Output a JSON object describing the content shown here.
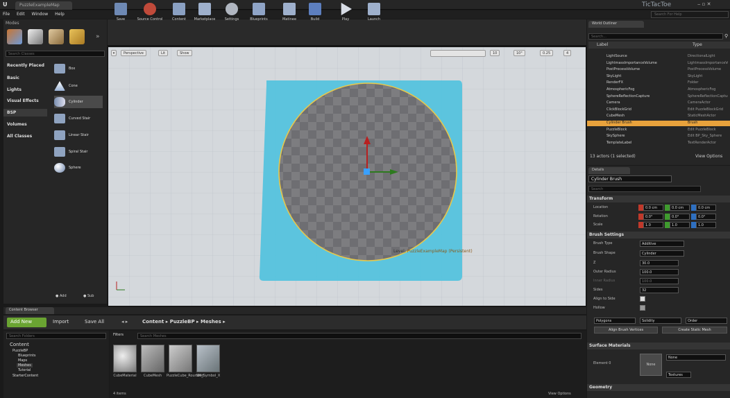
{
  "app": {
    "tab_label": "PuzzleExampleMap",
    "title": "TicTacToe",
    "search_help": "Search For Help"
  },
  "menu": [
    "File",
    "Edit",
    "Window",
    "Help"
  ],
  "modes": {
    "tab": "Modes",
    "search_placeholder": "Search Classes",
    "categories": [
      "Recently Placed",
      "Basic",
      "Lights",
      "Visual Effects",
      "BSP",
      "Volumes",
      "All Classes"
    ],
    "items": [
      "Box",
      "Cone",
      "Cylinder",
      "Curved Stair",
      "Linear Stair",
      "Spiral Stair",
      "Sphere"
    ],
    "footer": [
      "Add",
      "Sub"
    ]
  },
  "toolbar": [
    "Save",
    "Source Control",
    "Content",
    "Marketplace",
    "Settings",
    "Blueprints",
    "Matinee",
    "Build",
    "Play",
    "Launch"
  ],
  "viewport": {
    "perspective": "Perspective",
    "lit": "Lit",
    "show": "Show",
    "grid": "10",
    "angle": "10°",
    "scale": "0.25",
    "cams": "4",
    "level_prefix": "Level: ",
    "level_name": "PuzzleExampleMap (Persistent)"
  },
  "outliner": {
    "tab": "World Outliner",
    "search_placeholder": "Search...",
    "col_label": "Label",
    "col_type": "Type",
    "rows": [
      {
        "label": "LightSource",
        "type": "DirectionalLight"
      },
      {
        "label": "LightmassImportanceVolume",
        "type": "LightmassImportanceVolume"
      },
      {
        "label": "PostProcessVolume",
        "type": "PostProcessVolume"
      },
      {
        "label": "SkyLight",
        "type": "SkyLight"
      },
      {
        "label": "RenderFX",
        "type": "Folder"
      },
      {
        "label": "AtmosphericFog",
        "type": "AtmosphericFog"
      },
      {
        "label": "SphereReflectionCapture",
        "type": "SphereReflectionCapture"
      },
      {
        "label": "Camera",
        "type": "CameraActor"
      },
      {
        "label": "ClickBlockGrid",
        "type": "Edit PuzzleBlockGrid"
      },
      {
        "label": "CubeMesh",
        "type": "StaticMeshActor"
      },
      {
        "label": "Cylinder Brush",
        "type": "Brush"
      },
      {
        "label": "PuzzleBlock",
        "type": "Edit PuzzleBlock"
      },
      {
        "label": "SkySphere",
        "type": "Edit BP_Sky_Sphere"
      },
      {
        "label": "TemplateLabel",
        "type": "TextRenderActor"
      }
    ],
    "status": "13 actors (1 selected)",
    "view_options": "View Options"
  },
  "details": {
    "tab": "Details",
    "actor_name": "Cylinder Brush",
    "search_placeholder": "Search",
    "transform": "Transform",
    "location": "Location",
    "rotation": "Rotation",
    "scale": "Scale",
    "loc": [
      "0.0 cm",
      "0.0 cm",
      "0.0 cm"
    ],
    "rot": [
      "0.0°",
      "0.0°",
      "0.0°"
    ],
    "scl": [
      "1.0",
      "1.0",
      "1.0"
    ],
    "brush_settings": "Brush Settings",
    "brush_type": "Brush Type",
    "brush_type_val": "Additive",
    "brush_shape": "Brush Shape",
    "brush_shape_val": "Cylinder",
    "z": "Z",
    "z_val": "30.0",
    "outer": "Outer Radius",
    "outer_val": "100.0",
    "inner": "Inner Radius",
    "inner_val": "100.0",
    "sides": "Sides",
    "sides_val": "32",
    "align": "Align to Side",
    "hollow": "Hollow",
    "polygons": "Polygons",
    "solidity": "Solidity",
    "order": "Order",
    "align_btn": "Align Brush Vertices",
    "create_btn": "Create Static Mesh",
    "surface": "Surface Materials",
    "element": "Element 0",
    "none": "None",
    "textures": "Textures",
    "geometry": "Geometry"
  },
  "content": {
    "tab": "Content Browser",
    "add_new": "Add New",
    "import": "Import",
    "save_all": "Save All",
    "path": [
      "Content",
      "PuzzleBP",
      "Meshes"
    ],
    "search_folders": "Search Folders",
    "filters": "Filters",
    "search_assets": "Search Meshes",
    "tree": [
      "Content",
      "PuzzleBP",
      "Blueprints",
      "Maps",
      "Meshes",
      "Tutorial",
      "StarterContent"
    ],
    "assets": [
      "CubeMaterial",
      "CubeMesh",
      "PuzzleCube_Rounded",
      "SM_Symbol_X"
    ],
    "count": "4 items",
    "view_options": "View Options"
  }
}
